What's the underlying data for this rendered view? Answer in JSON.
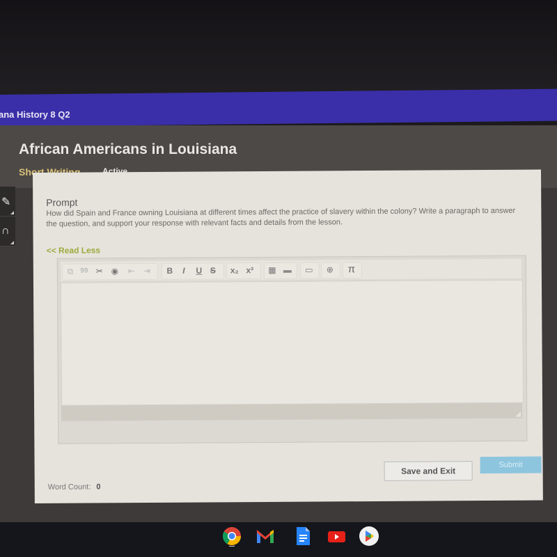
{
  "course": {
    "title": "ana History 8 Q2"
  },
  "lesson": {
    "title": "African Americans in Louisiana",
    "activity_type": "Short Writing",
    "status": "Active"
  },
  "side_tools": [
    {
      "name": "pencil-tool",
      "icon": "pencil-icon"
    },
    {
      "name": "audio-tool",
      "icon": "headphones-icon"
    }
  ],
  "prompt": {
    "label": "Prompt",
    "text": "How did Spain and France owning Louisiana at different times affect the practice of slavery within the colony? Write a paragraph to answer the question, and support your response with relevant facts and details from the lesson.",
    "toggle_label": "<< Read Less"
  },
  "editor": {
    "value": "",
    "toolbar": {
      "copy": "⧉",
      "quote": "99",
      "cut": "✂",
      "record": "◉",
      "indent_decrease": "⇤",
      "indent_increase": "⇥",
      "bold": "B",
      "italic": "I",
      "underline": "U",
      "strike": "S",
      "subscript": "x₂",
      "superscript": "x²",
      "table": "▦",
      "hr": "▬",
      "box": "▭",
      "globe": "⊕",
      "pi": "π"
    }
  },
  "footer": {
    "word_count_label": "Word Count:",
    "word_count": "0",
    "save_label": "Save and Exit",
    "submit_label": "Submit"
  },
  "shelf": {
    "apps": [
      "chrome",
      "gmail",
      "docs",
      "youtube",
      "play-store"
    ]
  }
}
